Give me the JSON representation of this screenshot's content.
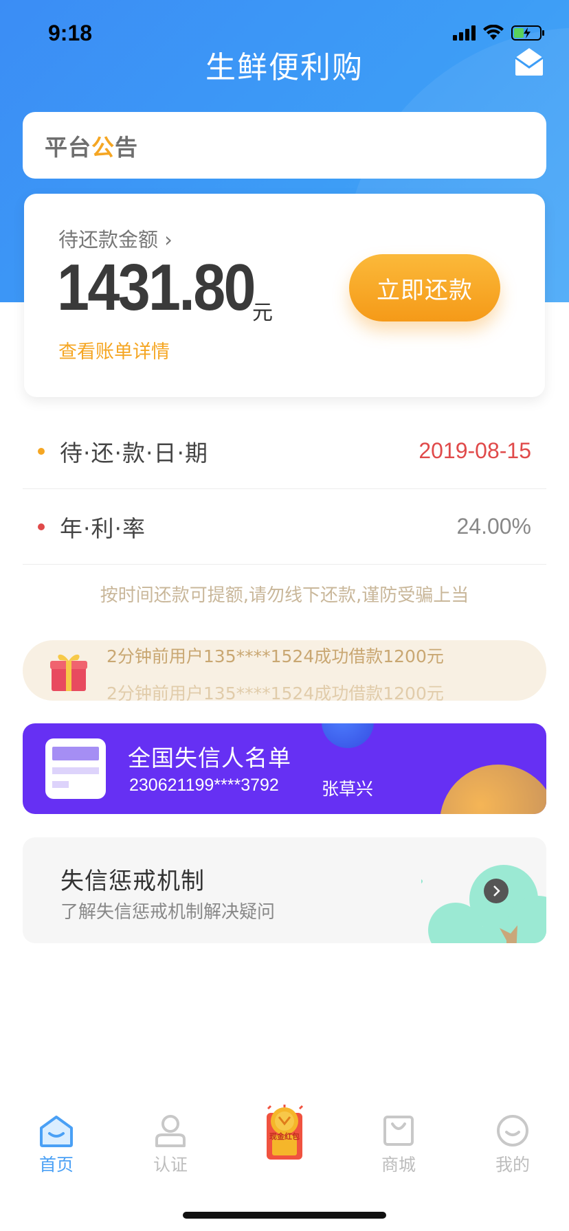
{
  "status_bar": {
    "time": "9:18",
    "icons": [
      "signal-icon",
      "wifi-icon",
      "battery-charging-icon"
    ]
  },
  "header": {
    "title": "生鲜便利购",
    "right_icon": "mail-icon"
  },
  "notice": {
    "text_main": "平台",
    "text_highlight": "公",
    "text_end": "告",
    "highlight_color": "#f5a623"
  },
  "repay_card": {
    "label": "待还款金额 ›",
    "amount": "1431.80",
    "unit": "元",
    "bill_link": "查看账单详情",
    "button": "立即还款"
  },
  "info_rows": [
    {
      "label": "待·还·款·日·期",
      "value": "2019-08-15",
      "dot_color": "#f5a623",
      "value_color": "#e04a4a"
    },
    {
      "label": "年·利·率",
      "value": "24.00%",
      "dot_color": "#e04a4a",
      "value_color": "#888888"
    }
  ],
  "tip": "按时间还款可提额,请勿线下还款,谨防受骗上当",
  "ticker": {
    "icon": "gift-icon",
    "lines": [
      "2分钟前用户135****1524成功借款1200元"
    ]
  },
  "blacklist": {
    "title": "全国失信人名单",
    "rows": [
      {
        "id": "230621199****3792",
        "name": "张草兴"
      }
    ]
  },
  "punish": {
    "title": "失信惩戒机制",
    "subtitle": "了解失信惩戒机制解决疑问"
  },
  "tabbar": {
    "items": [
      {
        "label": "首页",
        "icon": "home-icon"
      },
      {
        "label": "认证",
        "icon": "user-icon"
      },
      {
        "label": "现金红包",
        "icon": "red-packet-icon"
      },
      {
        "label": "商城",
        "icon": "shopping-bag-icon"
      },
      {
        "label": "我的",
        "icon": "smile-icon"
      }
    ],
    "active_color": "#4aa0f5",
    "inactive_color": "#bdbdbd"
  }
}
